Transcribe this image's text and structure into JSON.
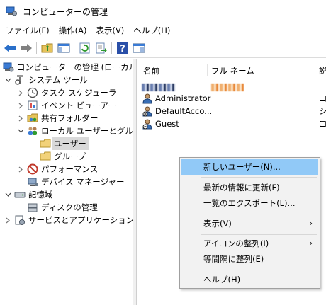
{
  "window": {
    "title": "コンピューターの管理"
  },
  "menu": [
    "ファイル(F)",
    "操作(A)",
    "表示(V)",
    "ヘルプ(H)"
  ],
  "toolbar": {
    "buttons": [
      "back-icon",
      "forward-icon",
      "up-folder-icon",
      "show-hide-tree-icon",
      "refresh-icon",
      "export-list-icon",
      "help-icon",
      "action-pane-icon"
    ],
    "accent": "#2a6fc9"
  },
  "tree": {
    "root": "コンピューターの管理 (ローカル)",
    "system_tools": "システム ツール",
    "task_scheduler": "タスク スケジューラ",
    "event_viewer": "イベント ビューアー",
    "shared_folders": "共有フォルダー",
    "local_users_groups": "ローカル ユーザーとグループ",
    "users": "ユーザー",
    "groups": "グループ",
    "performance": "パフォーマンス",
    "device_manager": "デバイス マネージャー",
    "storage": "記憶域",
    "disk_management": "ディスクの管理",
    "services_apps": "サービスとアプリケーション"
  },
  "list": {
    "columns": [
      "名前",
      "フル ネーム",
      "説"
    ],
    "rows": [
      {
        "name": "Administrator",
        "desc": "コ"
      },
      {
        "name": "DefaultAcco...",
        "desc": "シ"
      },
      {
        "name": "Guest",
        "desc": "コ"
      }
    ]
  },
  "context_menu": {
    "new_user": "新しいユーザー(N)...",
    "refresh": "最新の情報に更新(F)",
    "export_list": "一覧のエクスポート(L)...",
    "view": "表示(V)",
    "arrange_icons": "アイコンの整列(I)",
    "line_up_icons": "等間隔に整列(E)",
    "help": "ヘルプ(H)",
    "submenu_arrow": "›",
    "highlight_color": "#91c9f7"
  }
}
